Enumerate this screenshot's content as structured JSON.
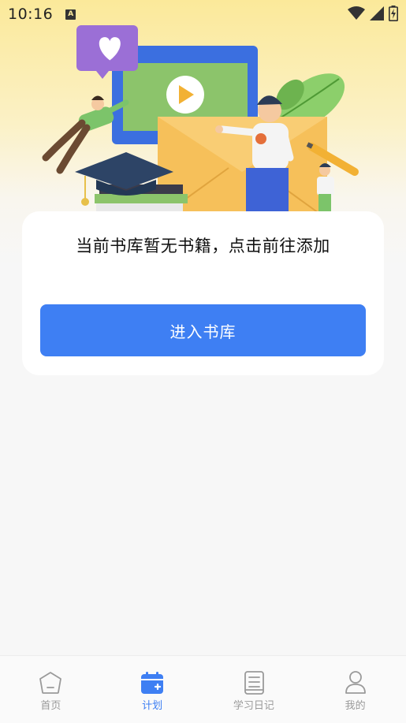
{
  "status_bar": {
    "time": "10:16",
    "notification_icon": "a-icon",
    "icons": [
      "wifi-icon",
      "signal-icon",
      "battery-charging-icon"
    ]
  },
  "empty_state": {
    "message": "当前书库暂无书籍，点击前往添加",
    "button_label": "进入书库"
  },
  "tab_bar": {
    "active": "plan",
    "items": [
      {
        "id": "home",
        "label": "首页",
        "icon": "home-icon"
      },
      {
        "id": "plan",
        "label": "计划",
        "icon": "calendar-add-icon"
      },
      {
        "id": "diary",
        "label": "学习日记",
        "icon": "notebook-icon"
      },
      {
        "id": "mine",
        "label": "我的",
        "icon": "user-icon"
      }
    ]
  },
  "colors": {
    "accent": "#3e7ff3",
    "header_yellow": "#fbe99a",
    "inactive_tab": "#9a9a9a"
  }
}
